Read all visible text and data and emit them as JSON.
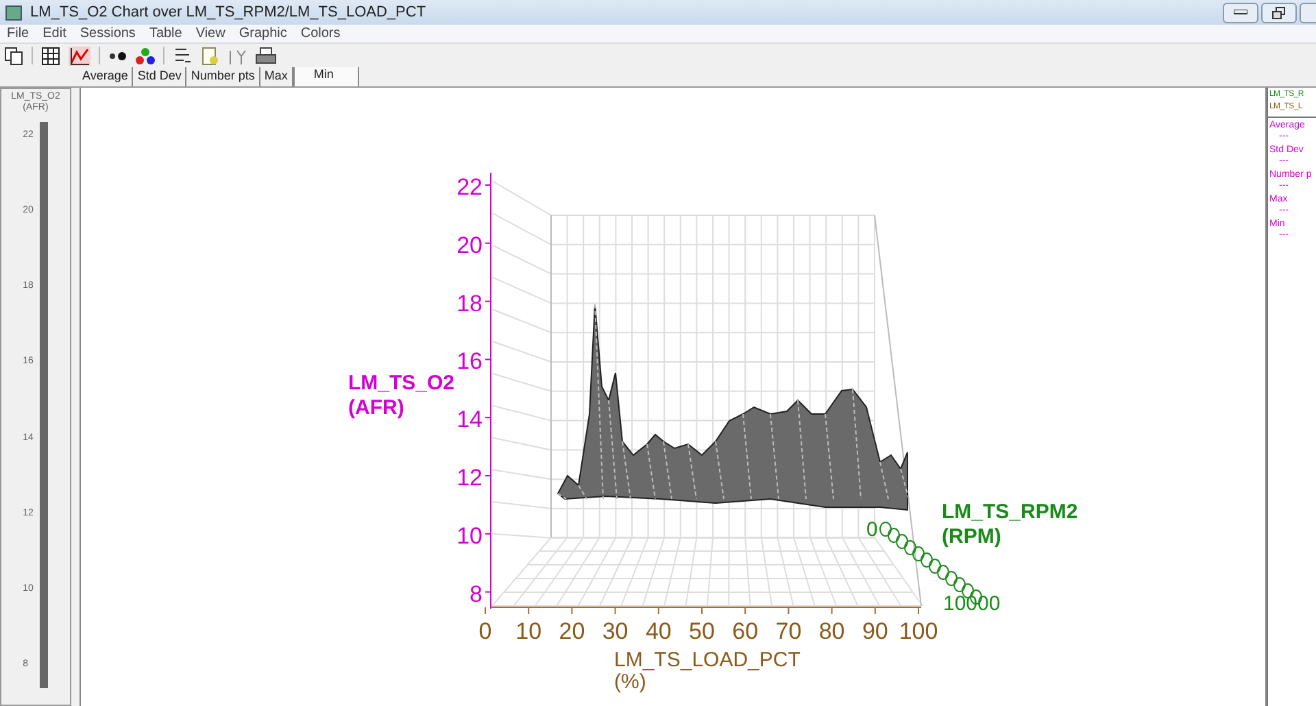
{
  "window": {
    "title": "LM_TS_O2 Chart over LM_TS_RPM2/LM_TS_LOAD_PCT"
  },
  "menu": [
    "File",
    "Edit",
    "Sessions",
    "Table",
    "View",
    "Graphic",
    "Colors"
  ],
  "tabs": [
    {
      "label": "Average",
      "selected": false
    },
    {
      "label": "Std Dev",
      "selected": false
    },
    {
      "label": "Number pts",
      "selected": false
    },
    {
      "label": "Max",
      "selected": false
    },
    {
      "label": "Min",
      "selected": true
    }
  ],
  "left_gauge": {
    "title": "LM_TS_O2",
    "unit": "(AFR)",
    "ticks": [
      "22",
      "20",
      "18",
      "16",
      "14",
      "12",
      "10",
      "8"
    ]
  },
  "chart": {
    "y_title": "LM_TS_O2",
    "y_unit": "(AFR)",
    "y_ticks": [
      "22",
      "20",
      "18",
      "16",
      "14",
      "12",
      "10",
      "8"
    ],
    "x_title": "LM_TS_LOAD_PCT",
    "x_unit": "(%)",
    "x_ticks": [
      "0",
      "10",
      "20",
      "30",
      "40",
      "50",
      "60",
      "70",
      "80",
      "90",
      "100"
    ],
    "z_title": "LM_TS_RPM2",
    "z_unit": "(RPM)",
    "z_ticks": [
      "0",
      "10000"
    ]
  },
  "legend": {
    "series": [
      {
        "label": "LM_TS_R",
        "color": "#1a8a1a"
      },
      {
        "label": "LM_TS_L",
        "color": "#8b5a1a"
      }
    ],
    "stats": [
      {
        "label": "Average",
        "value": "---"
      },
      {
        "label": "Std Dev",
        "value": "---"
      },
      {
        "label": "Number p",
        "value": "---"
      },
      {
        "label": "Max",
        "value": "---"
      },
      {
        "label": "Min",
        "value": "---"
      }
    ]
  }
}
